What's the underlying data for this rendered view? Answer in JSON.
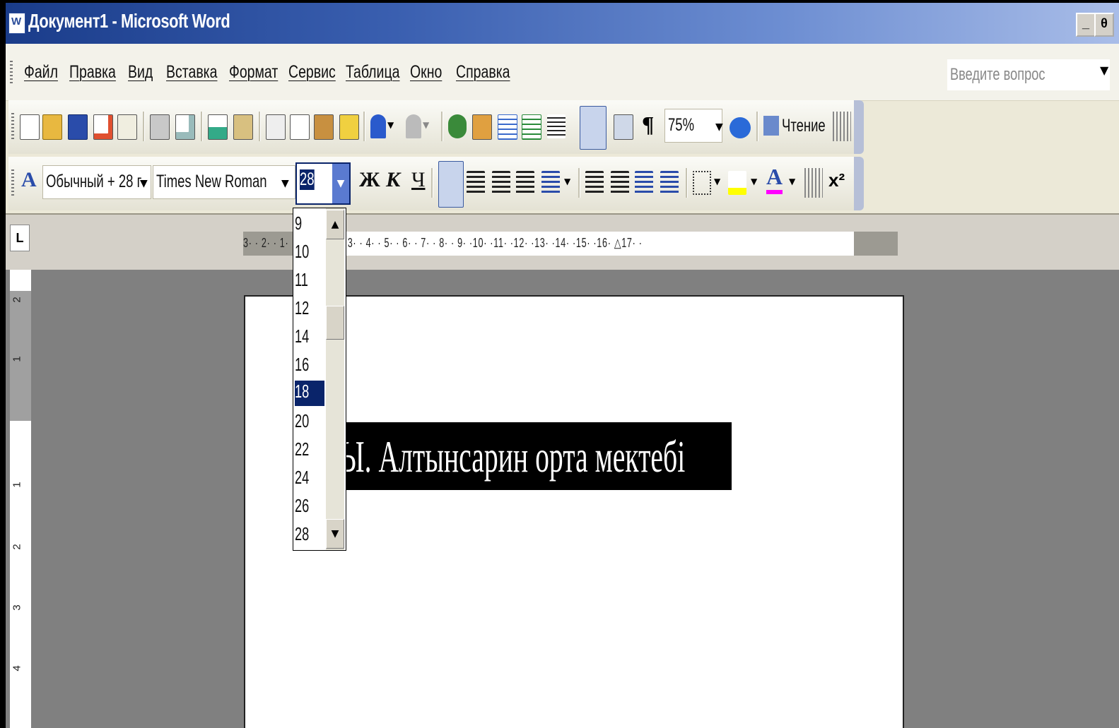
{
  "window": {
    "title": "Документ1 - Microsoft Word",
    "minimize": "_",
    "restore": "θ"
  },
  "menu": [
    "Файл",
    "Правка",
    "Вид",
    "Вставка",
    "Формат",
    "Сервис",
    "Таблица",
    "Окно",
    "Справка"
  ],
  "help_search": {
    "placeholder": "Введите вопрос"
  },
  "standard_toolbar": {
    "icons": [
      "new-document-icon",
      "open-folder-icon",
      "save-icon",
      "permission-icon",
      "email-icon",
      "print-icon",
      "print-preview-icon",
      "spelling-icon",
      "research-icon",
      "cut-icon",
      "copy-icon",
      "paste-icon",
      "format-painter-icon",
      "undo-icon",
      "redo-icon",
      "hyperlink-icon",
      "tables-borders-icon",
      "insert-table-icon",
      "insert-excel-icon",
      "columns-icon",
      "drawing-icon",
      "document-map-icon",
      "show-formatting-icon"
    ],
    "pilcrow": "¶",
    "zoom": "75%",
    "reading_label": "Чтение"
  },
  "formatting_toolbar": {
    "style": "Обычный + 28 г",
    "font": "Times New Roman",
    "font_size": "28",
    "bold": "Ж",
    "italic": "К",
    "underline": "Ч",
    "superscript": "x²"
  },
  "font_size_list": {
    "items": [
      "9",
      "10",
      "11",
      "12",
      "14",
      "16",
      "18",
      "20",
      "22",
      "24",
      "26",
      "28"
    ],
    "highlighted": "18"
  },
  "ruler": {
    "horizontal": "3· · 2· · 1· · · · 1· · 2· · 3· · 4· · 5· · 6· · 7· · 8· · 9· ·10· ·11· ·12· ·13· ·14· ·15· ·16· △17· ·",
    "vertical": [
      "2",
      "1",
      "1",
      "2",
      "3",
      "4"
    ]
  },
  "document": {
    "selected_text": "Ы. Алтынсарин орта мектебі"
  },
  "colors": {
    "title_start": "#1a3c8a",
    "selection": "#0a246a",
    "highlight": "#ffff00",
    "font_color": "#ff00ff"
  }
}
